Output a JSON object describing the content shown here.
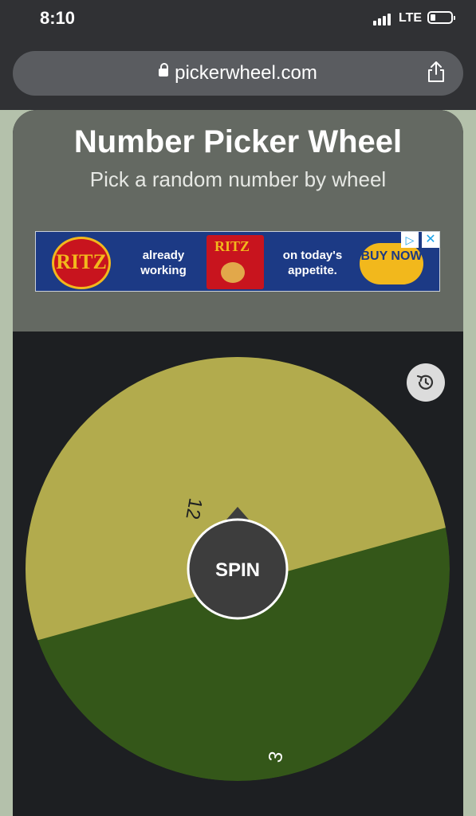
{
  "status_bar": {
    "time": "8:10",
    "network": "LTE"
  },
  "browser": {
    "url": "pickerwheel.com",
    "lock_icon": "lock-icon",
    "share_icon": "share-icon"
  },
  "page": {
    "title": "Number Picker Wheel",
    "subtitle": "Pick a random number by wheel"
  },
  "ad": {
    "brand": "RITZ",
    "text1": "already working",
    "box_brand": "RITZ",
    "text2": "on today's appetite.",
    "cta": "BUY NOW",
    "adchoices_icon": "adchoices-icon",
    "close_icon": "close-icon"
  },
  "wheel": {
    "history_icon": "history-icon",
    "spin_label": "SPIN",
    "segments": [
      {
        "label": "12",
        "color": "#b2ab4d"
      },
      {
        "label": "3",
        "color": "#345719"
      }
    ]
  },
  "colors": {
    "page_bg": "#b4c1ab",
    "header_bg": "#646962",
    "wheel_area_bg": "#1d1f22",
    "spin_button": "#3d3d3d"
  }
}
